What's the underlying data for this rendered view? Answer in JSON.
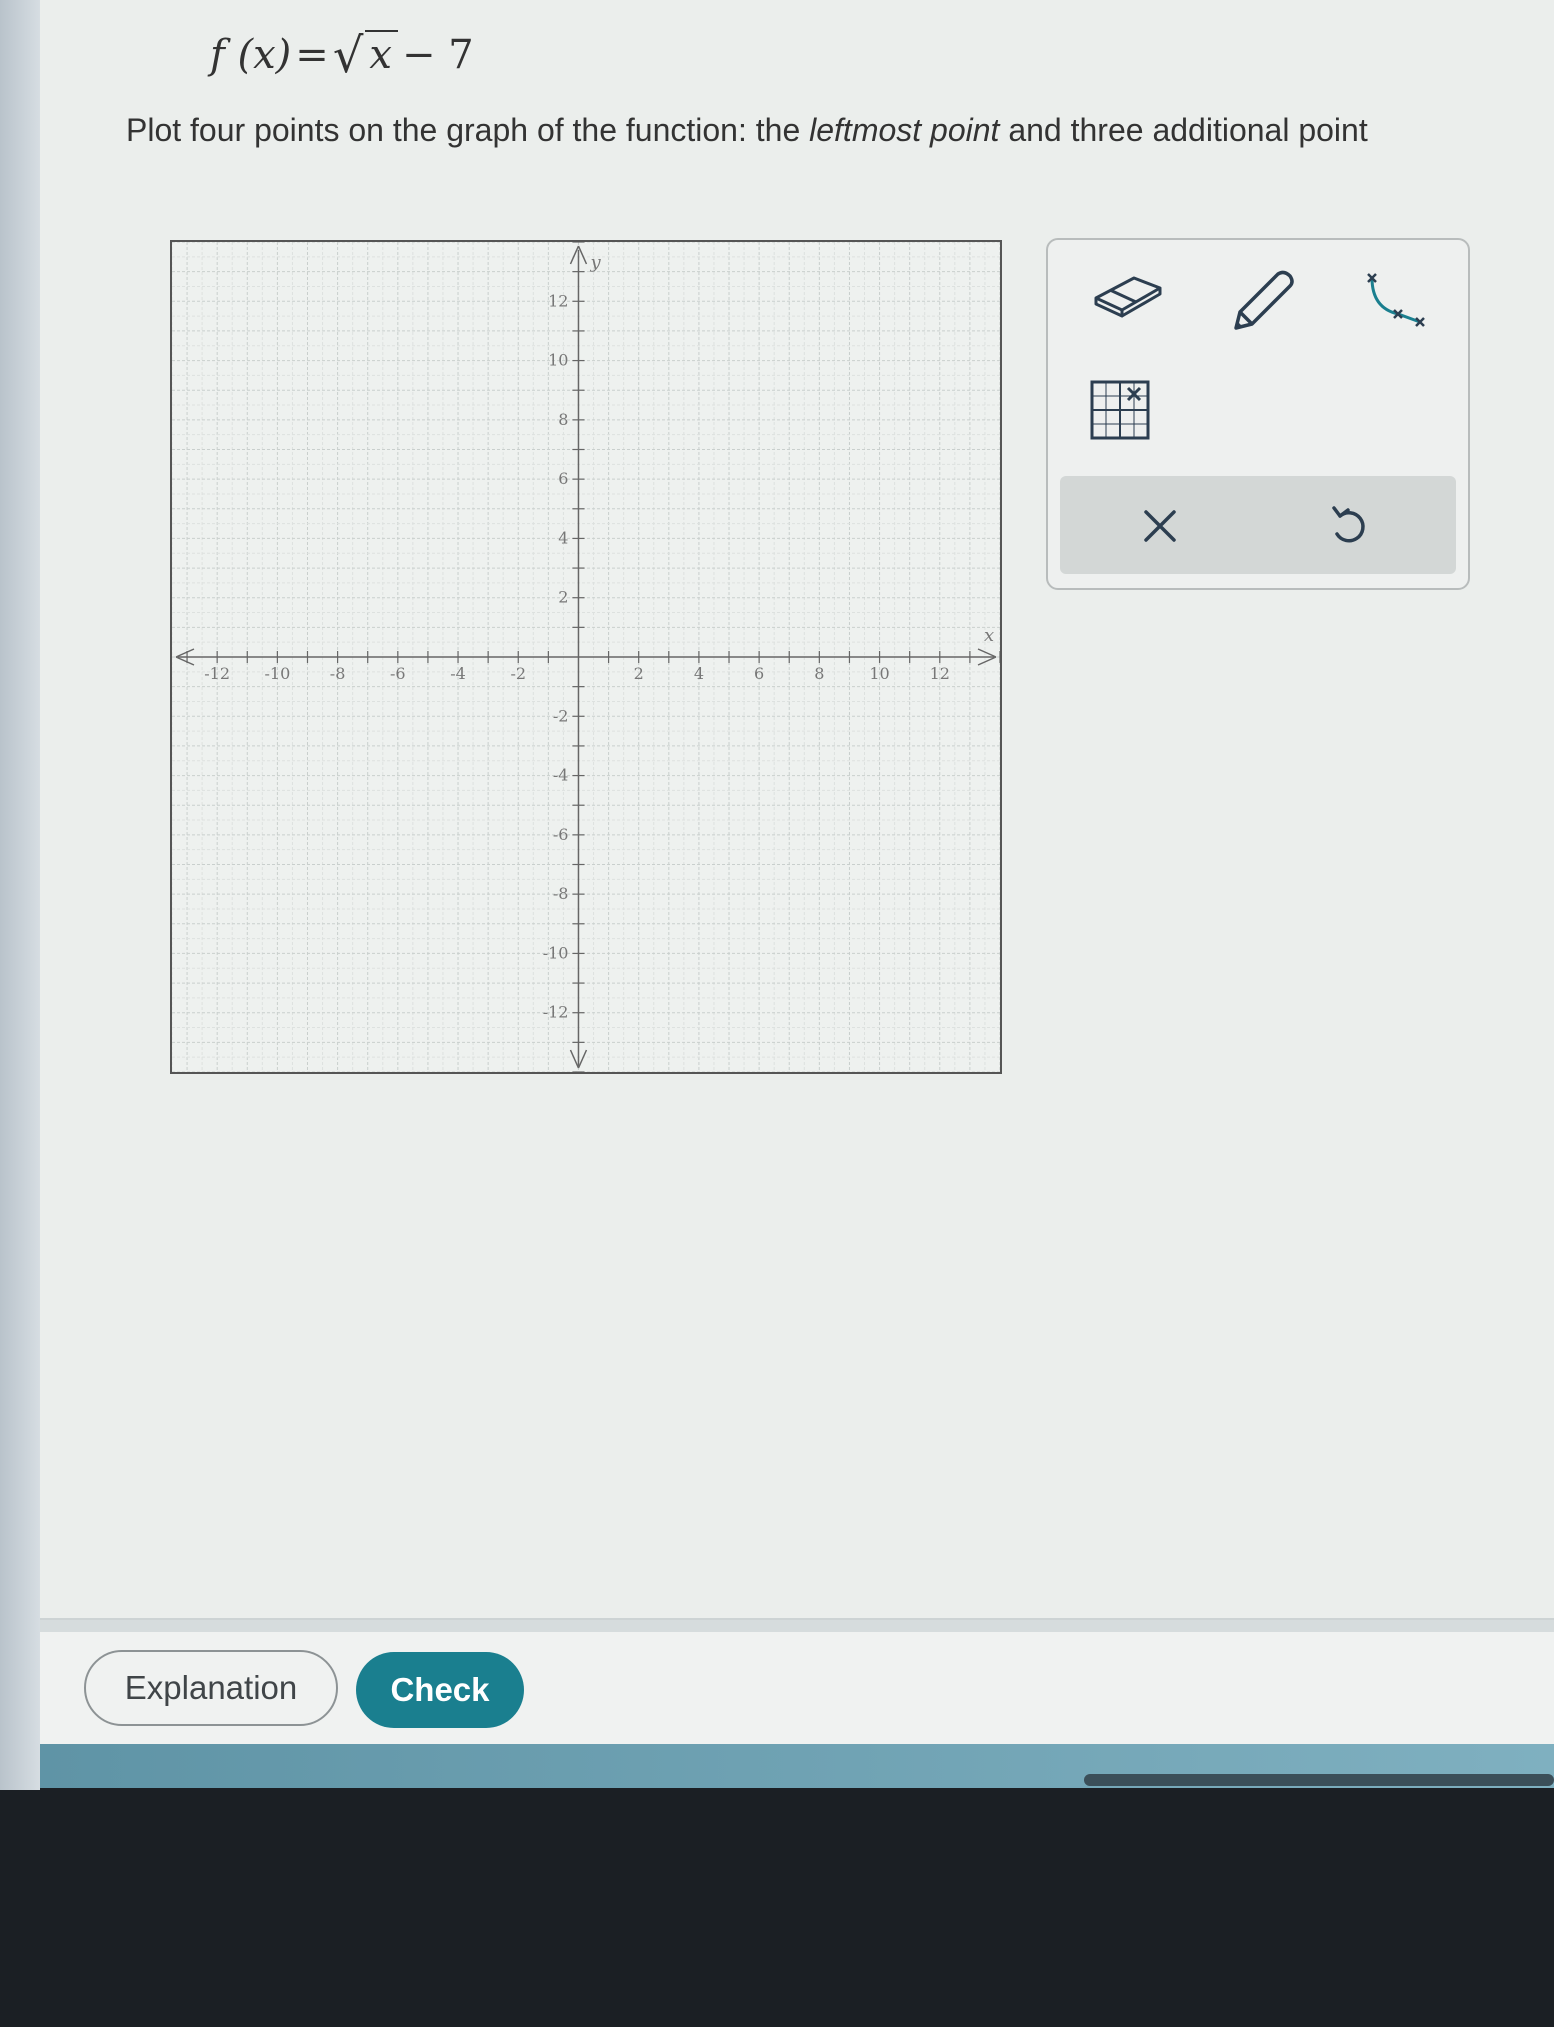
{
  "problem": {
    "formula_fx": "f (x)",
    "formula_eq": "=",
    "formula_radicand": "x",
    "formula_tail": "− 7",
    "prompt_start": "Plot four points on the graph of the function: the ",
    "prompt_emphasis": "leftmost point",
    "prompt_end": " and three additional point"
  },
  "graph": {
    "x_axis_label": "x",
    "y_axis_label": "y",
    "x_ticks": [
      "-12",
      "-10",
      "-8",
      "-6",
      "-4",
      "-2",
      "2",
      "4",
      "6",
      "8",
      "10",
      "12"
    ],
    "y_ticks": [
      "12",
      "10",
      "8",
      "6",
      "4",
      "2",
      "-2",
      "-4",
      "-6",
      "-8",
      "-10",
      "-12"
    ],
    "x_range": [
      -13.5,
      14
    ],
    "y_range": [
      -14,
      14
    ]
  },
  "tools": {
    "eraser": "eraser-icon",
    "pencil": "pencil-icon",
    "curve": "curve-points-icon",
    "grid": "grid-point-icon",
    "clear": "x-icon",
    "undo": "undo-icon"
  },
  "footer": {
    "explanation_label": "Explanation",
    "check_label": "Check"
  },
  "colors": {
    "check_button": "#1a7f8f",
    "graph_background": "#eef1ef",
    "page_background": "#ebeeec"
  }
}
